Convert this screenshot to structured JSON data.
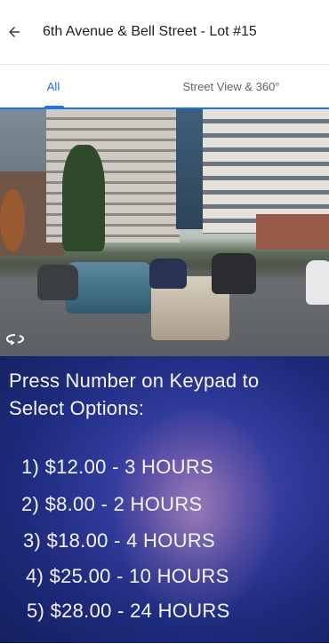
{
  "header": {
    "title": "6th Avenue & Bell Street - Lot #15"
  },
  "tabs": [
    {
      "label": "All",
      "active": true
    },
    {
      "label": "Street View & 360°",
      "active": false
    }
  ],
  "keypad_photo": {
    "prompt": "Press Number on Keypad to Select Options:",
    "options": [
      "1) $12.00 - 3 HOURS",
      "2) $8.00 - 2 HOURS",
      "3) $18.00 - 4 HOURS",
      "4) $25.00 - 10 HOURS",
      "5) $28.00 - 24 HOURS"
    ]
  },
  "icons": {
    "back": "arrow-back-icon",
    "rotate": "rotate-360-icon"
  },
  "colors": {
    "accent": "#1a73e8",
    "keypad_bg": "#1d2a7a"
  }
}
